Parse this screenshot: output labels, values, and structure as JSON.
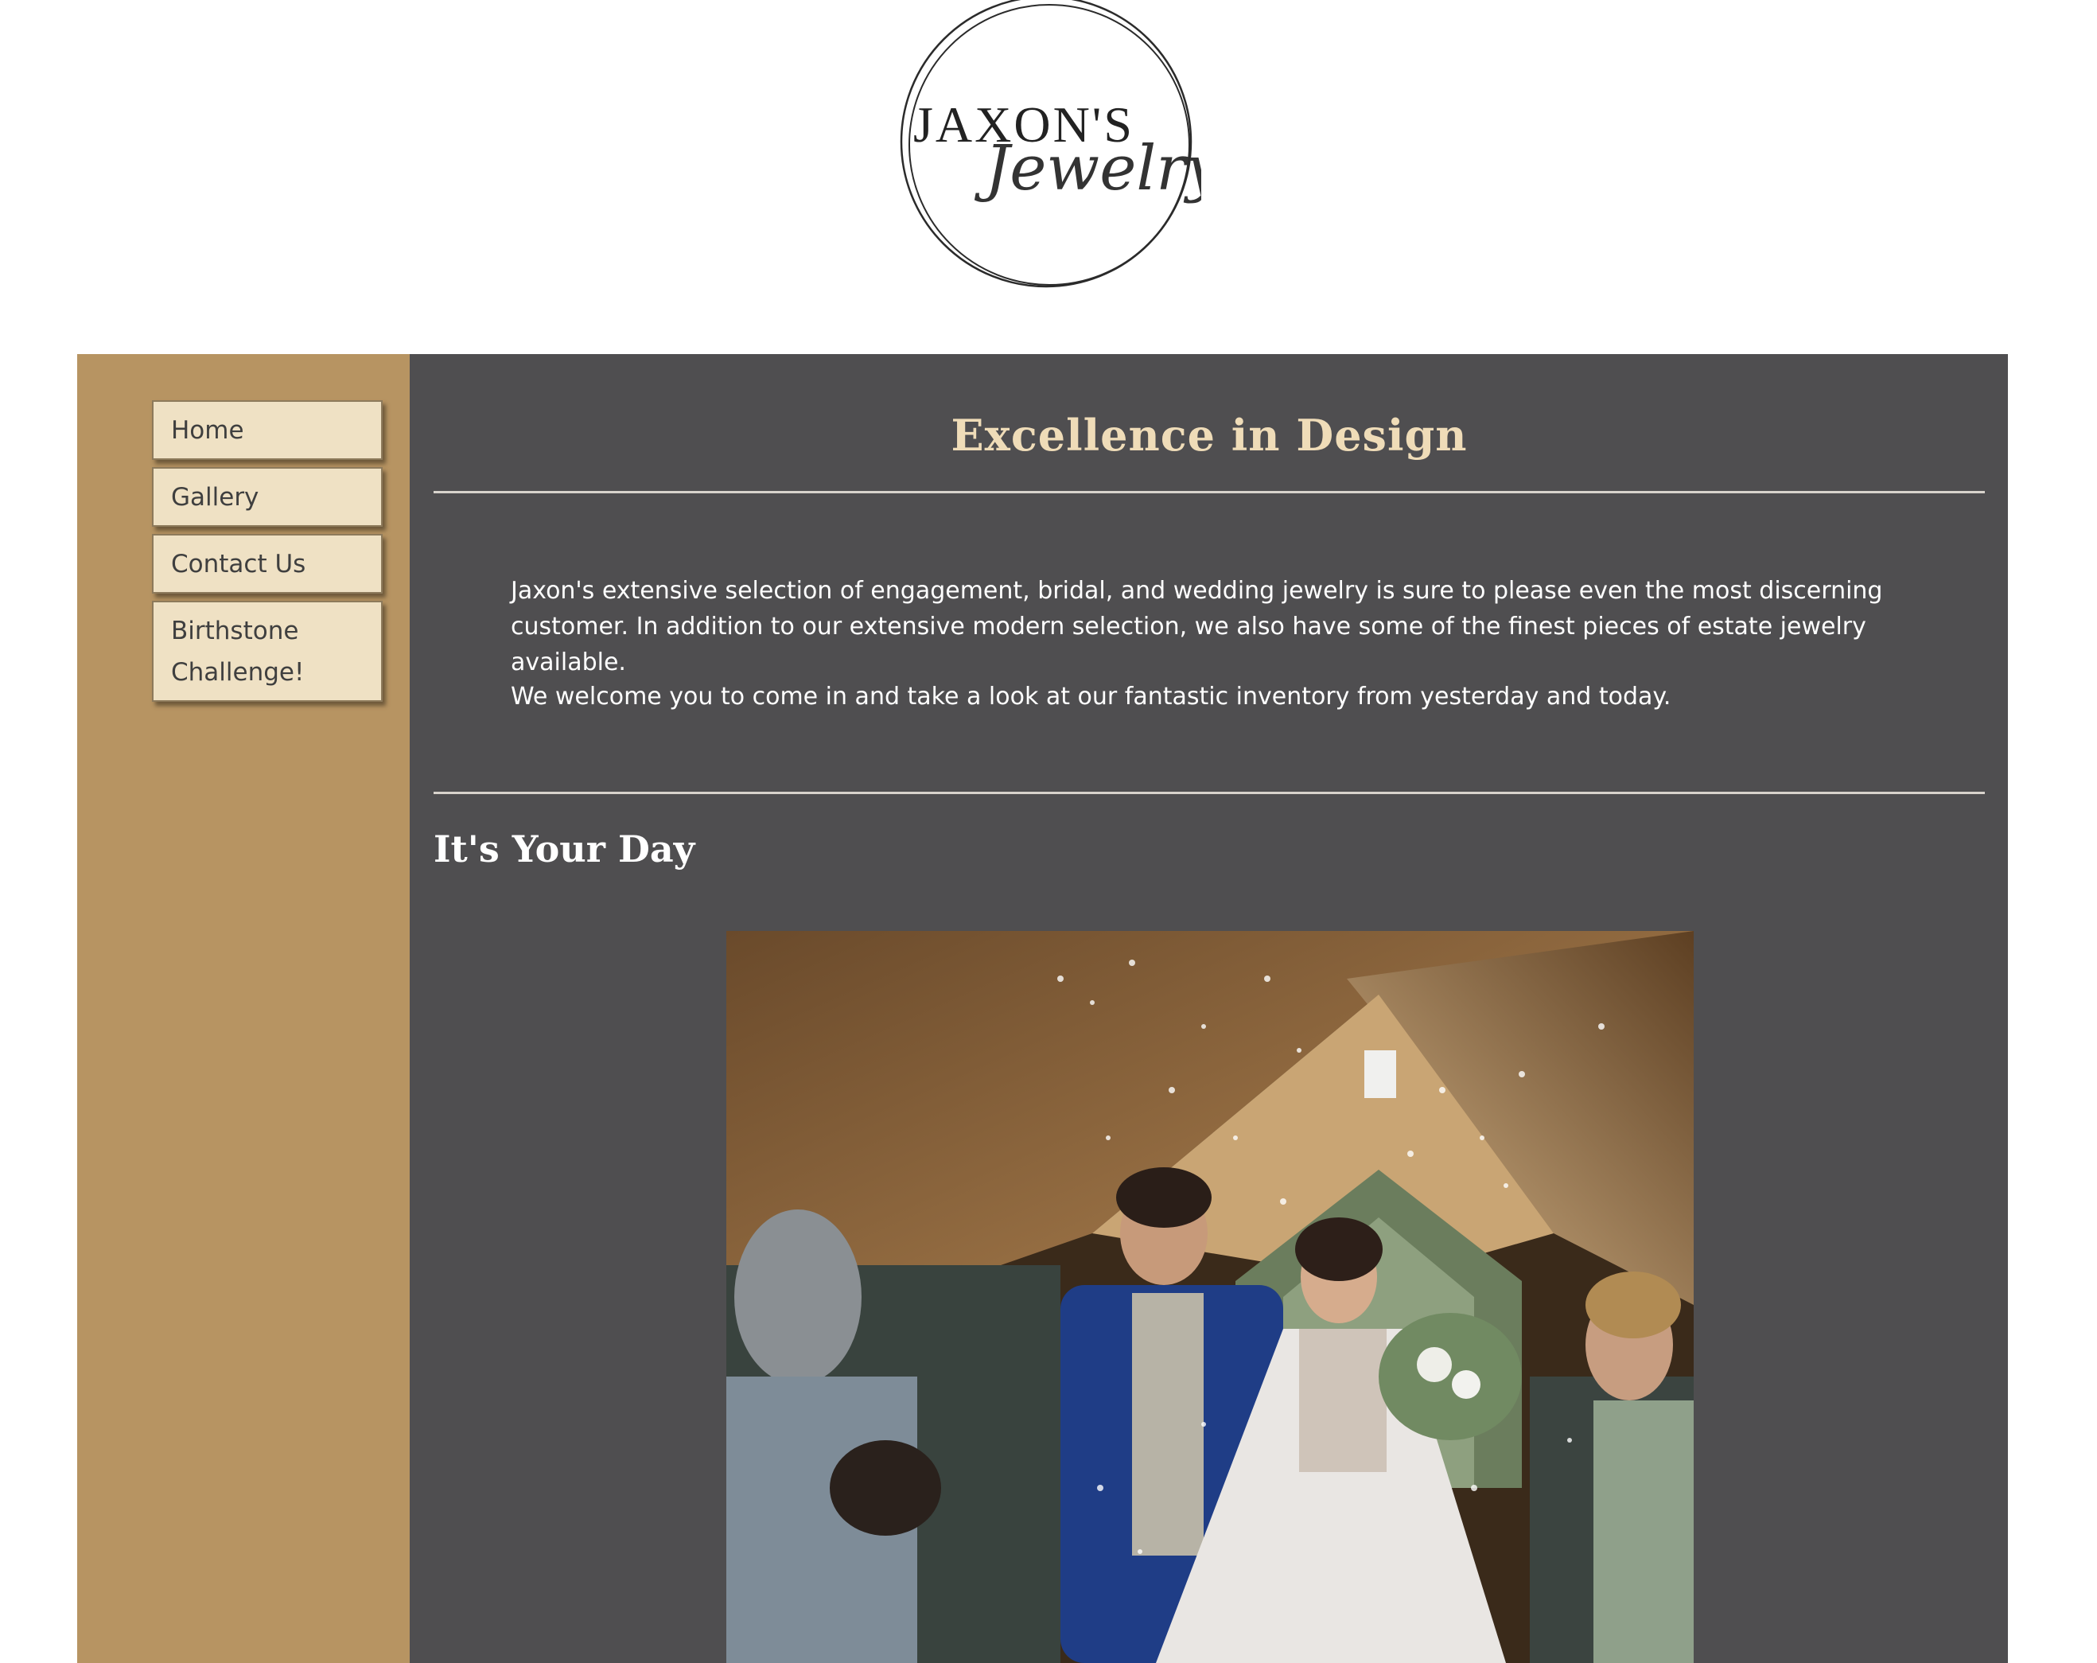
{
  "brand": {
    "logo_line1": "JAXON'S",
    "logo_line2": "Jewelry"
  },
  "nav": {
    "items": [
      {
        "label": "Home"
      },
      {
        "label": "Gallery"
      },
      {
        "label": "Contact Us"
      },
      {
        "label": "Birthstone Challenge!"
      }
    ]
  },
  "main": {
    "title": "Excellence in Design",
    "paragraph1": "Jaxon's extensive selection of engagement, bridal, and wedding jewelry is sure to please even the most discerning customer. In addition to our extensive modern selection, we also have some of the finest pieces of estate jewelry available.",
    "paragraph2": "We welcome you to come in and take a look at our fantastic inventory from yesterday and today.",
    "subtitle": "It's Your Day"
  },
  "colors": {
    "sidebar": "#b79462",
    "content_bg": "#4f4e50",
    "nav_bg": "#efe1c4",
    "title": "#efdcb8"
  }
}
